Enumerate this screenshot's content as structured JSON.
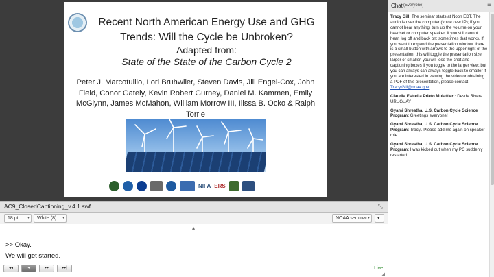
{
  "slide": {
    "title": "Recent North American Energy Use and GHG Trends: Will the Cycle be Unbroken?",
    "adapted": "Adapted from:",
    "subtitle": "State of the State of the Carbon Cycle 2",
    "authors": "Peter J. Marcotullio, Lori Bruhwiler, Steven Davis, Jill Engel-Cox, John Field, Conor Gately, Kevin Robert Gurney, Daniel M. Kammen, Emily McGlynn, James McMahon, William Morrow III, Ilissa B. Ocko & Ralph Torrie",
    "logos": [
      "NIFA",
      "ERS"
    ]
  },
  "captions_pod": {
    "title": "AC9_ClosedCaptioning_v.4.1.swf",
    "font_size": "18 pt",
    "color": "White (8)",
    "source": "NOAA seminar",
    "lines": [
      ">> Okay.",
      "We will get started."
    ],
    "status": "Live"
  },
  "chat": {
    "title": "Chat",
    "scope": "(Everyone)",
    "messages": [
      {
        "author": "Tracy Gill:",
        "text": " The seminar starts at Noon EDT. The audio is over the computer (voice over IP); if you cannot hear anything, turn up the volume on your headset or computer speaker. If you still cannot hear, log off and back on; sometimes that works. If you want to expand the presentation window, there is a small button with arrows to the upper right of the presentation; this will toggle the presentation size larger or smaller, you will lose the chat and captioning boxes if you toggle to the larger view, but you can always can always toggle back to smaller if you are interested in viewing the video or obtaining a PDF of this presentation, please contact ",
        "link": "Tracy.Gill@noaa.gov"
      },
      {
        "author": "Claudia Estrella Prieto Mulattieri:",
        "text": " Desde Rivera URUGUAY"
      },
      {
        "author": "Gyami Shrestha, U.S. Carbon Cycle Science Program:",
        "text": " Greetings everyone!"
      },
      {
        "author": "Gyami Shrestha, U.S. Carbon Cycle Science Program:",
        "text": " Tracy.. Please add me again on speaker role."
      },
      {
        "author": "Gyami Shrestha, U.S. Carbon Cycle Science Program:",
        "text": " I was kicked out when my PC suddenly restarted."
      }
    ]
  },
  "colors": {
    "accent_link": "#1a4fb5",
    "live_green": "#2e8b2e",
    "dark_bg": "#3a3a3a"
  }
}
